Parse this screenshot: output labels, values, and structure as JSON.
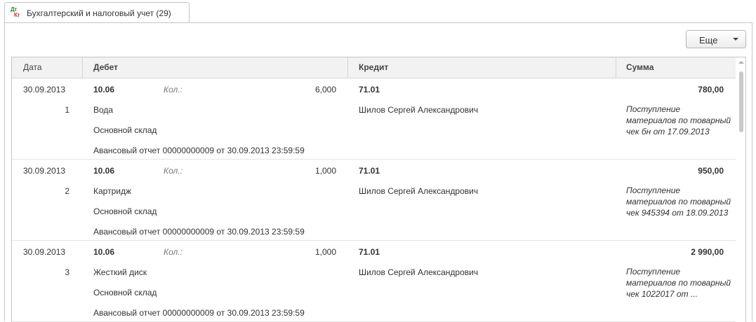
{
  "tab": {
    "icon_top": "Дт",
    "icon_bottom": "Кт",
    "title": "Бухгалтерский и налоговый учет (29)"
  },
  "toolbar": {
    "more_label": "Еще"
  },
  "columns": {
    "date": "Дата",
    "debit": "Дебет",
    "credit": "Кредит",
    "sum": "Сумма"
  },
  "rows": [
    {
      "date": "30.09.2013",
      "num": "1",
      "debit_account": "10.06",
      "qty_label": "Кол.:",
      "qty": "6,000",
      "debit_sub1": "Вода",
      "debit_sub2": "Основной склад",
      "debit_sub3": "Авансовый отчет 00000000009 от 30.09.2013 23:59:59",
      "credit_account": "71.01",
      "credit_sub1": "Шилов Сергей Александрович",
      "amount": "780,00",
      "description": "Поступление материалов по товарный чек бн от 17.09.2013"
    },
    {
      "date": "30.09.2013",
      "num": "2",
      "debit_account": "10.06",
      "qty_label": "Кол.:",
      "qty": "1,000",
      "debit_sub1": "Картридж",
      "debit_sub2": "Основной склад",
      "debit_sub3": "Авансовый отчет 00000000009 от 30.09.2013 23:59:59",
      "credit_account": "71.01",
      "credit_sub1": "Шилов Сергей Александрович",
      "amount": "950,00",
      "description": "Поступление материалов по товарный чек 945394 от 18.09.2013"
    },
    {
      "date": "30.09.2013",
      "num": "3",
      "debit_account": "10.06",
      "qty_label": "Кол.:",
      "qty": "1,000",
      "debit_sub1": "Жесткий диск",
      "debit_sub2": "Основной склад",
      "debit_sub3": "Авансовый отчет 00000000009 от 30.09.2013 23:59:59",
      "credit_account": "71.01",
      "credit_sub1": "Шилов Сергей Александрович",
      "amount": "2 990,00",
      "description": "Поступление материалов по товарный чек 1022017 от ..."
    }
  ]
}
